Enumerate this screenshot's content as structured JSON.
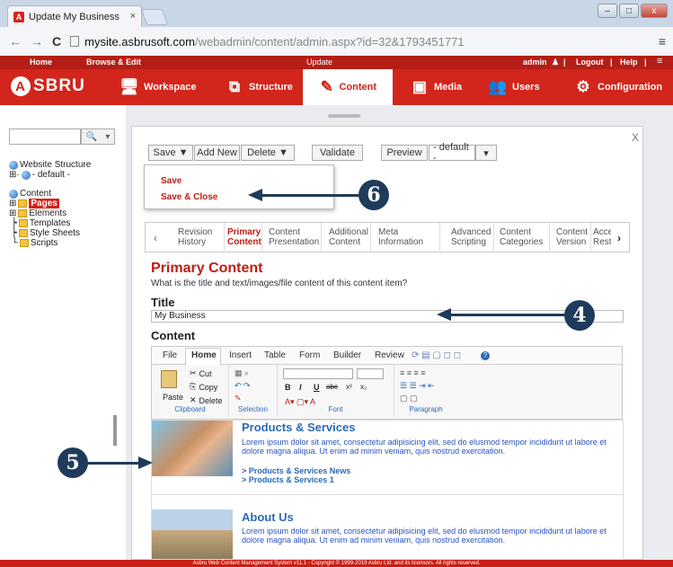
{
  "browser": {
    "tab_title": "Update My Business",
    "tab_favicon": "A",
    "tab_close": "×",
    "url_host": "mysite.asbrusoft.com",
    "url_path": "/webadmin/content/admin.aspx?id=32&1793451771",
    "back": "←",
    "forward": "→",
    "reload": "C",
    "menu": "≡",
    "win_min": "–",
    "win_max": "□",
    "win_close": "x"
  },
  "topbar": {
    "home": "Home",
    "browse_edit": "Browse & Edit",
    "update": "Update",
    "admin": "admin",
    "logout": "Logout",
    "help": "Help",
    "sep": "|",
    "menu": "≡"
  },
  "mainnav": {
    "logo": "SBRU",
    "logo_mark": "A",
    "items": [
      {
        "label": "Workspace",
        "icon": "workspace-icon"
      },
      {
        "label": "Structure",
        "icon": "structure-icon"
      },
      {
        "label": "Content",
        "icon": "content-icon"
      },
      {
        "label": "Media",
        "icon": "media-icon"
      },
      {
        "label": "Users",
        "icon": "users-icon"
      },
      {
        "label": "Configuration",
        "icon": "gear-icon"
      }
    ],
    "active": "Content"
  },
  "sidebar": {
    "search_placeholder": "",
    "tree": {
      "website_structure": "Website Structure",
      "default": "- default -",
      "content": "Content",
      "pages": "Pages",
      "elements": "Elements",
      "templates": "Templates",
      "style_sheets": "Style Sheets",
      "scripts": "Scripts"
    }
  },
  "toolbar": {
    "save": "Save ▼",
    "add_new": "Add New",
    "delete": "Delete ▼",
    "validate": "Validate",
    "preview": "Preview",
    "preview_select": "- default -",
    "close": "X"
  },
  "save_menu": {
    "save": "Save",
    "save_close": "Save & Close"
  },
  "tabs": [
    {
      "line1": "Revision",
      "line2": "History"
    },
    {
      "line1": "Primary",
      "line2": "Content"
    },
    {
      "line1": "Content",
      "line2": "Presentation"
    },
    {
      "line1": "Additional",
      "line2": "Content"
    },
    {
      "line1": "Meta",
      "line2": "Information"
    },
    {
      "line1": "Advanced",
      "line2": "Scripting"
    },
    {
      "line1": "Content",
      "line2": "Categories"
    },
    {
      "line1": "Content",
      "line2": "Version"
    },
    {
      "line1": "Acce",
      "line2": "Rest"
    }
  ],
  "tab_prev": "‹",
  "tab_next": "›",
  "form": {
    "heading": "Primary Content",
    "subheading": "What is the title and text/images/file content of this content item?",
    "title_label": "Title",
    "title_value": "My Business",
    "content_label": "Content"
  },
  "editor": {
    "menu": [
      "File",
      "Home",
      "Insert",
      "Table",
      "Form",
      "Builder",
      "Review"
    ],
    "clipboard": {
      "paste": "Paste",
      "cut": "Cut",
      "copy": "Copy",
      "delete": "Delete",
      "label": "Clipboard"
    },
    "selection_label": "Selection",
    "font_label": "Font",
    "paragraph_label": "Paragraph",
    "font_b": "B",
    "font_i": "I",
    "font_u": "U",
    "font_s": "abc",
    "font_sup": "x²",
    "font_sub": "x₂"
  },
  "content": {
    "block1_heading": "Products & Services",
    "block1_text": "Lorem ipsum dolor sit amet, consectetur adipisicing elit, sed do elusmod tempor incididunt ut labore et dolore magna aliqua. Ut enim ad minim veniam, quis nostrud exercitation.",
    "link1": "> Products & Services News",
    "link2": "> Products & Services 1",
    "block2_heading": "About Us",
    "block2_text": "Lorem ipsum dolor sit amet, consectetur adipisicing elit, sed do elusmod tempor incididunt ut labore et dolore magna aliqua. Ut enim ad minim veniam, quis nostrud exercitation."
  },
  "footer": "Asbru Web Content Management System v11.1 - Copyright © 1999-2019 Asbru Ltd. and its licensors. All rights reserved.",
  "callouts": {
    "c4": "4",
    "c5": "5",
    "c6": "6"
  },
  "colors": {
    "brand_red": "#d2251b",
    "link_blue": "#2a6ab8",
    "callout_navy": "#1f3b5c"
  }
}
